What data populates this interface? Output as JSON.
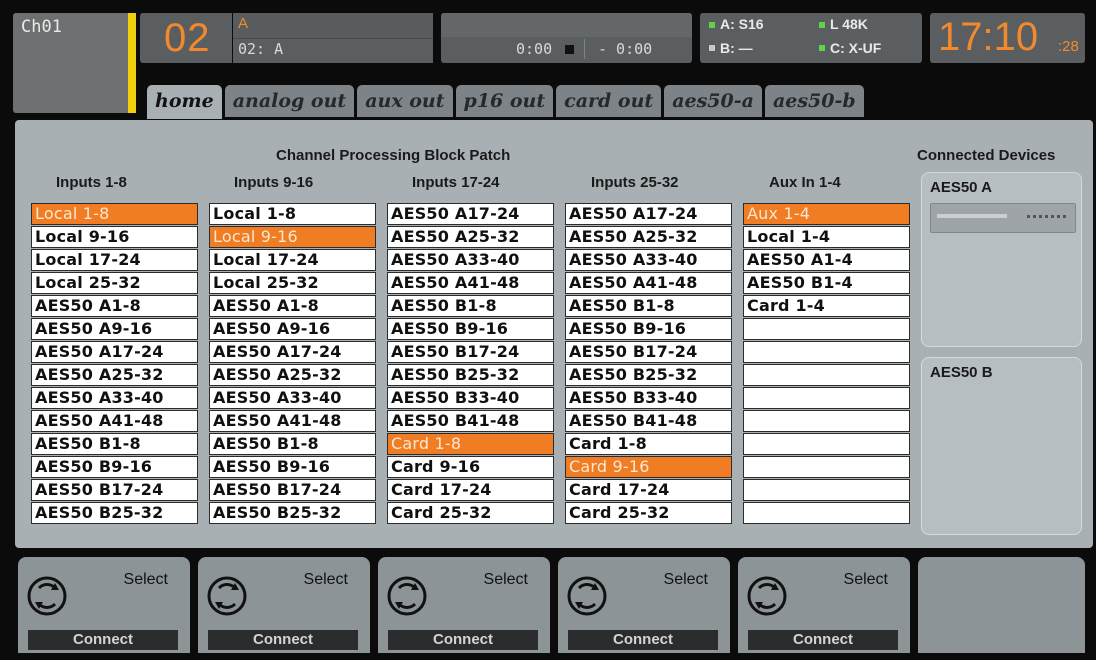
{
  "channel": {
    "label": "Ch01"
  },
  "channel_number": "02",
  "channel_name": {
    "line1": "A",
    "line2": "02: A"
  },
  "transport": {
    "elapsed": "0:00",
    "remaining": "- 0:00"
  },
  "sync": {
    "a_label": "A: S16",
    "b_label": "B: —",
    "l_label": "L  48K",
    "c_label": "C: X-UF"
  },
  "clock": {
    "hm": "17:10",
    "sec": ":28"
  },
  "tabs": [
    "home",
    "analog out",
    "aux out",
    "p16 out",
    "card out",
    "aes50-a",
    "aes50-b"
  ],
  "patch": {
    "title": "Channel Processing Block Patch",
    "columns": [
      {
        "header": "Inputs 1-8",
        "items": [
          "Local 1-8",
          "Local 9-16",
          "Local 17-24",
          "Local 25-32",
          "AES50 A1-8",
          "AES50 A9-16",
          "AES50 A17-24",
          "AES50 A25-32",
          "AES50 A33-40",
          "AES50 A41-48",
          "AES50 B1-8",
          "AES50 B9-16",
          "AES50 B17-24",
          "AES50 B25-32"
        ],
        "selected": 0
      },
      {
        "header": "Inputs 9-16",
        "items": [
          "Local 1-8",
          "Local 9-16",
          "Local 17-24",
          "Local 25-32",
          "AES50 A1-8",
          "AES50 A9-16",
          "AES50 A17-24",
          "AES50 A25-32",
          "AES50 A33-40",
          "AES50 A41-48",
          "AES50 B1-8",
          "AES50 B9-16",
          "AES50 B17-24",
          "AES50 B25-32"
        ],
        "selected": 1
      },
      {
        "header": "Inputs 17-24",
        "items": [
          "AES50 A17-24",
          "AES50 A25-32",
          "AES50 A33-40",
          "AES50 A41-48",
          "AES50 B1-8",
          "AES50 B9-16",
          "AES50 B17-24",
          "AES50 B25-32",
          "AES50 B33-40",
          "AES50 B41-48",
          "Card 1-8",
          "Card 9-16",
          "Card 17-24",
          "Card 25-32"
        ],
        "selected": 10
      },
      {
        "header": "Inputs 25-32",
        "items": [
          "AES50 A17-24",
          "AES50 A25-32",
          "AES50 A33-40",
          "AES50 A41-48",
          "AES50 B1-8",
          "AES50 B9-16",
          "AES50 B17-24",
          "AES50 B25-32",
          "AES50 B33-40",
          "AES50 B41-48",
          "Card 1-8",
          "Card 9-16",
          "Card 17-24",
          "Card 25-32"
        ],
        "selected": 11
      },
      {
        "header": "Aux In 1-4",
        "items": [
          "Aux 1-4",
          "Local 1-4",
          "AES50 A1-4",
          "AES50 B1-4",
          "Card 1-4",
          "",
          "",
          "",
          "",
          "",
          "",
          "",
          "",
          ""
        ],
        "selected": 0
      }
    ]
  },
  "devices": {
    "title": "Connected Devices",
    "a_label": "AES50 A",
    "b_label": "AES50 B"
  },
  "encoders": [
    {
      "select": "Select",
      "connect": "Connect"
    },
    {
      "select": "Select",
      "connect": "Connect"
    },
    {
      "select": "Select",
      "connect": "Connect"
    },
    {
      "select": "Select",
      "connect": "Connect"
    },
    {
      "select": "Select",
      "connect": "Connect"
    }
  ],
  "colors": {
    "accent": "#f28a2b",
    "selected_cell": "#f07d23",
    "panel": "#a9b0b3",
    "sync_led": "#5fd14a"
  }
}
